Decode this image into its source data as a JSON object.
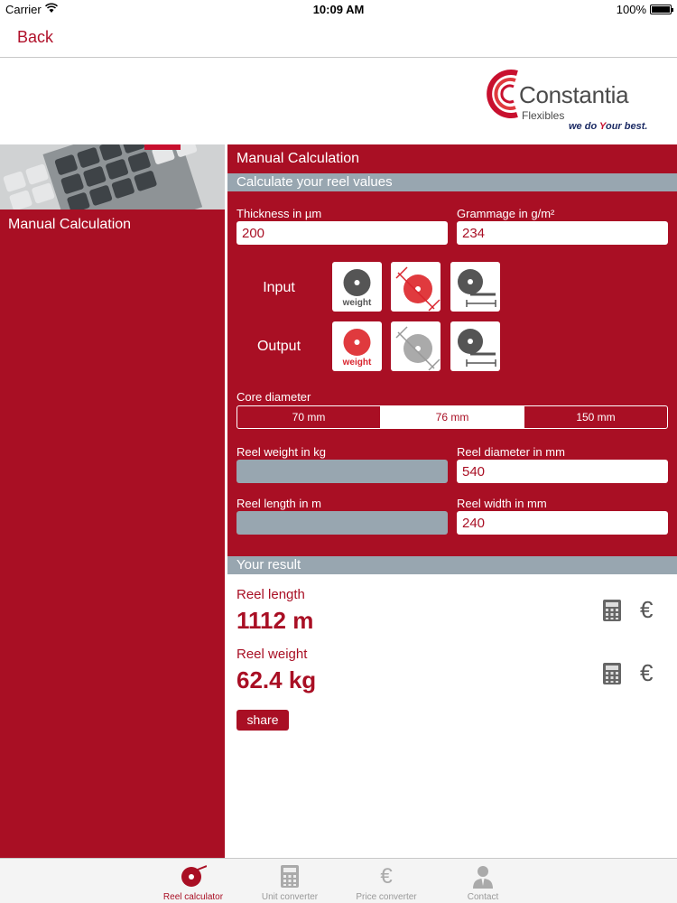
{
  "status_bar": {
    "carrier": "Carrier",
    "time": "10:09 AM",
    "battery": "100%"
  },
  "nav": {
    "back_label": "Back"
  },
  "logo": {
    "brand": "Constantia",
    "sub": "Flexibles",
    "tagline_pre": "we do ",
    "tagline_y": "Y",
    "tagline_post": "our best."
  },
  "sidebar": {
    "selected_item": "Manual Calculation"
  },
  "form": {
    "title": "Manual Calculation",
    "section_title": "Calculate your reel values",
    "thickness": {
      "label": "Thickness in µm",
      "value": "200"
    },
    "grammage": {
      "label": "Grammage in g/m²",
      "value": "234"
    },
    "input_label": "Input",
    "output_label": "Output",
    "weight_caption": "weight",
    "core_diameter": {
      "label": "Core diameter",
      "options": [
        "70 mm",
        "76 mm",
        "150 mm"
      ],
      "selected": "76 mm"
    },
    "reel_weight": {
      "label": "Reel weight in kg",
      "value": ""
    },
    "reel_diameter": {
      "label": "Reel diameter in mm",
      "value": "540"
    },
    "reel_length": {
      "label": "Reel length in m",
      "value": ""
    },
    "reel_width": {
      "label": "Reel width in mm",
      "value": "240"
    }
  },
  "result": {
    "section_title": "Your result",
    "length_label": "Reel length",
    "length_value": "1112 m",
    "weight_label": "Reel weight",
    "weight_value": "62.4 kg",
    "share_label": "share"
  },
  "tabbar": {
    "tabs": [
      {
        "label": "Reel calculator",
        "icon": "reel-icon",
        "active": true
      },
      {
        "label": "Unit converter",
        "icon": "calculator-icon",
        "active": false
      },
      {
        "label": "Price converter",
        "icon": "euro-icon",
        "active": false
      },
      {
        "label": "Contact",
        "icon": "person-icon",
        "active": false
      }
    ]
  },
  "colors": {
    "brand_red": "#a90f24",
    "accent_red": "#d9232d",
    "section_gray": "#98a6b0"
  }
}
